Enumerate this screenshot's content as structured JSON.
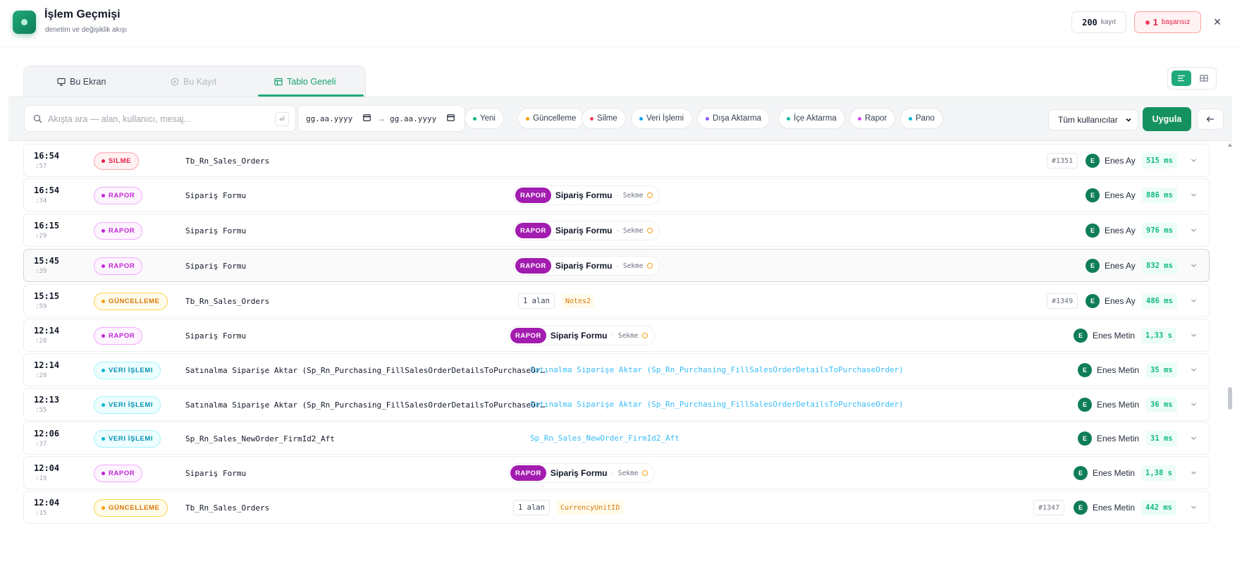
{
  "header": {
    "title": "İşlem Geçmişi",
    "subtitle": "denetim ve değişiklik akışı",
    "record_count": "200",
    "record_label": "kayıt",
    "fail_count": "1",
    "fail_label": "başarısız",
    "close_glyph": "×"
  },
  "tabs": [
    {
      "label": "Bu Ekran",
      "icon": "monitor-icon",
      "state": "normal"
    },
    {
      "label": "Bu Kayıt",
      "icon": "target-icon",
      "state": "disabled"
    },
    {
      "label": "Tablo Geneli",
      "icon": "table-icon",
      "state": "active"
    }
  ],
  "view_toggle": {
    "active": "list-view",
    "options": [
      "list-view-icon",
      "grid-view-icon"
    ]
  },
  "filters": {
    "search_placeholder": "Akışta ara — alan, kullanıcı, mesaj...",
    "search_value": "",
    "search_hint": "⏎",
    "date_from": "gg.aa.yyyy",
    "date_arrow": "→",
    "date_to": "gg.aa.yyyy",
    "chips": [
      {
        "label": "Yeni",
        "color": "#10b981"
      },
      {
        "label": "Güncelleme",
        "color": "#f59e0b"
      },
      {
        "label": "Silme",
        "color": "#f43f5e"
      },
      {
        "label": "Veri İşlemi",
        "color": "#0ea5e9"
      },
      {
        "label": "Dışa Aktarma",
        "color": "#8b5cf6"
      },
      {
        "label": "İçe Aktarma",
        "color": "#14b8a6"
      },
      {
        "label": "Rapor",
        "color": "#d946ef"
      },
      {
        "label": "Pano",
        "color": "#06b6d4"
      }
    ],
    "user_select": "Tüm kullanıcılar",
    "apply_label": "Uygula"
  },
  "rows": [
    {
      "time": "16:54",
      "sec": ":57",
      "type": "silme",
      "badge": "SILME",
      "target": "Tb_Rn_Sales_Orders",
      "summary_kind": "none",
      "record_id": "#1351",
      "avatar": "E",
      "user": "Enes Ay",
      "duration": "515 ms"
    },
    {
      "time": "16:54",
      "sec": ":34",
      "type": "rapor",
      "badge": "RAPOR",
      "target": "Sipariş Formu",
      "summary_kind": "rapor",
      "rapor_tag": "RAPOR",
      "rapor_name": "Sipariş Formu",
      "rapor_sep": "·",
      "rapor_kind": "Sekme",
      "avatar": "E",
      "user": "Enes Ay",
      "duration": "886 ms"
    },
    {
      "time": "16:15",
      "sec": ":29",
      "type": "rapor",
      "badge": "RAPOR",
      "target": "Sipariş Formu",
      "summary_kind": "rapor",
      "rapor_tag": "RAPOR",
      "rapor_name": "Sipariş Formu",
      "rapor_sep": "·",
      "rapor_kind": "Sekme",
      "avatar": "E",
      "user": "Enes Ay",
      "duration": "976 ms"
    },
    {
      "time": "15:45",
      "sec": ":39",
      "type": "rapor",
      "badge": "RAPOR",
      "target": "Sipariş Formu",
      "summary_kind": "rapor",
      "rapor_tag": "RAPOR",
      "rapor_name": "Sipariş Formu",
      "rapor_sep": "·",
      "rapor_kind": "Sekme",
      "avatar": "E",
      "user": "Enes Ay",
      "duration": "832 ms",
      "highlighted": true
    },
    {
      "time": "15:15",
      "sec": ":59",
      "type": "guncelleme",
      "badge": "GÜNCELLEME",
      "target": "Tb_Rn_Sales_Orders",
      "summary_kind": "update",
      "field_count": "1 alan",
      "field_name": "Notes2",
      "record_id": "#1349",
      "avatar": "E",
      "user": "Enes Ay",
      "duration": "486 ms"
    },
    {
      "time": "12:14",
      "sec": ":28",
      "type": "rapor",
      "badge": "RAPOR",
      "target": "Sipariş Formu",
      "summary_kind": "rapor",
      "rapor_tag": "RAPOR",
      "rapor_name": "Sipariş Formu",
      "rapor_sep": "·",
      "rapor_kind": "Sekme",
      "avatar": "E",
      "user": "Enes Metin",
      "duration": "1,33 s"
    },
    {
      "time": "12:14",
      "sec": ":20",
      "type": "veri",
      "badge": "VERI İŞLEMI",
      "target": "Satınalma Siparişe Aktar (Sp_Rn_Purchasing_FillSalesOrderDetailsToPurchaseOrder)",
      "summary_kind": "proc",
      "proc_text": "Satınalma Siparişe Aktar (Sp_Rn_Purchasing_FillSalesOrderDetailsToPurchaseOrder)",
      "avatar": "E",
      "user": "Enes Metin",
      "duration": "35 ms"
    },
    {
      "time": "12:13",
      "sec": ":55",
      "type": "veri",
      "badge": "VERI İŞLEMI",
      "target": "Satınalma Siparişe Aktar (Sp_Rn_Purchasing_FillSalesOrderDetailsToPurchaseOrder)",
      "summary_kind": "proc",
      "proc_text": "Satınalma Siparişe Aktar (Sp_Rn_Purchasing_FillSalesOrderDetailsToPurchaseOrder)",
      "avatar": "E",
      "user": "Enes Metin",
      "duration": "36 ms"
    },
    {
      "time": "12:06",
      "sec": ":37",
      "type": "veri",
      "badge": "VERI İŞLEMI",
      "target": "Sp_Rn_Sales_NewOrder_FirmId2_Aft",
      "summary_kind": "proc",
      "proc_text": "Sp_Rn_Sales_NewOrder_FirmId2_Aft",
      "avatar": "E",
      "user": "Enes Metin",
      "duration": "31 ms"
    },
    {
      "time": "12:04",
      "sec": ":19",
      "type": "rapor",
      "badge": "RAPOR",
      "target": "Sipariş Formu",
      "summary_kind": "rapor",
      "rapor_tag": "RAPOR",
      "rapor_name": "Sipariş Formu",
      "rapor_sep": "·",
      "rapor_kind": "Sekme",
      "avatar": "E",
      "user": "Enes Metin",
      "duration": "1,38 s"
    },
    {
      "time": "12:04",
      "sec": ":15",
      "type": "guncelleme",
      "badge": "GÜNCELLEME",
      "target": "Tb_Rn_Sales_Orders",
      "summary_kind": "update",
      "field_count": "1 alan",
      "field_name": "CurrencyUnitID",
      "record_id": "#1347",
      "avatar": "E",
      "user": "Enes Metin",
      "duration": "442 ms"
    }
  ],
  "colors": {
    "accent": "#1faa7a",
    "apply": "#14915f"
  }
}
